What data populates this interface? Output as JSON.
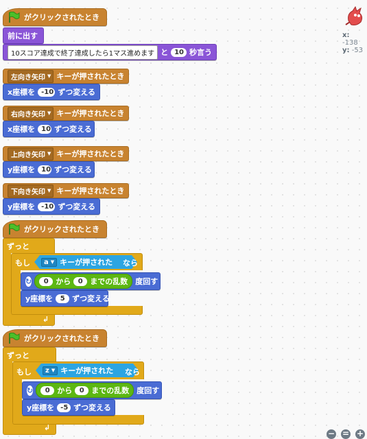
{
  "script1": {
    "hat_label": "がクリックされたとき",
    "move_label": "前に出す",
    "say_text": "10スコア達成で終了達成したら1マス進めます",
    "say_and": "と",
    "say_secs": "10",
    "say_suffix": "秒言う"
  },
  "key_scripts": [
    {
      "key": "左向き矢印",
      "hat_suffix": "キーが押されたとき",
      "coord_label": "x座標を",
      "value": "-10",
      "change_suffix": "ずつ変える"
    },
    {
      "key": "右向き矢印",
      "hat_suffix": "キーが押されたとき",
      "coord_label": "x座標を",
      "value": "10",
      "change_suffix": "ずつ変える"
    },
    {
      "key": "上向き矢印",
      "hat_suffix": "キーが押されたとき",
      "coord_label": "y座標を",
      "value": "10",
      "change_suffix": "ずつ変える"
    },
    {
      "key": "下向き矢印",
      "hat_suffix": "キーが押されたとき",
      "coord_label": "y座標を",
      "value": "-10",
      "change_suffix": "ずつ変える"
    }
  ],
  "loop_scripts": [
    {
      "hat_label": "がクリックされたとき",
      "forever": "ずっと",
      "if": "もし",
      "key": "a",
      "pressed": "キーが押された",
      "then": "なら",
      "rand_from": "0",
      "rand_kara": "から",
      "rand_to": "0",
      "rand_made": "までの乱数",
      "repeat_suffix": "度回す",
      "coord_label": "y座標を",
      "value": "5",
      "change_suffix": "ずつ変える"
    },
    {
      "hat_label": "がクリックされたとき",
      "forever": "ずっと",
      "if": "もし",
      "key": "z",
      "pressed": "キーが押された",
      "then": "なら",
      "rand_from": "0",
      "rand_kara": "から",
      "rand_to": "0",
      "rand_made": "までの乱数",
      "repeat_suffix": "度回す",
      "coord_label": "y座標を",
      "value": "-5",
      "change_suffix": "ずつ変える"
    }
  ],
  "sprite_info": {
    "x_label": "x:",
    "x_value": "-138",
    "y_label": "y:",
    "y_value": "-53"
  },
  "zoom": {
    "out": "−",
    "reset": "=",
    "in": "+"
  },
  "colors": {
    "events": "#c88330",
    "looks": "#8a55d7",
    "motion": "#4a6cd4",
    "control": "#e1a91a",
    "sensing": "#2ca5e2",
    "operators": "#5cb712"
  },
  "icons": [
    "green-flag-icon",
    "dropdown-arrow-icon",
    "repeat-loop-icon",
    "loop-return-arrow-icon",
    "sprite-thumbnail-icon",
    "zoom-out-icon",
    "zoom-reset-icon",
    "zoom-in-icon"
  ]
}
